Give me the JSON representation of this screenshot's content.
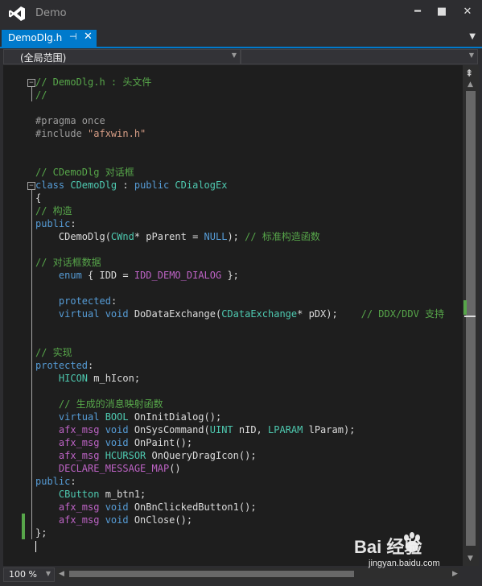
{
  "window": {
    "title": "Demo",
    "minimize": "━",
    "maximize": "■",
    "close": "✕"
  },
  "tab": {
    "label": "DemoDlg.h",
    "pin": "⊣",
    "close": "✕"
  },
  "navbar": {
    "scope": "(全局范围)",
    "member": ""
  },
  "code_lines": [
    [
      [
        "c-com",
        "// DemoDlg.h : 头文件"
      ]
    ],
    [
      [
        "c-com",
        "//"
      ]
    ],
    [],
    [
      [
        "c-pre",
        "#pragma once"
      ]
    ],
    [
      [
        "c-pre",
        "#include "
      ],
      [
        "c-str",
        "\"afxwin.h\""
      ]
    ],
    [],
    [],
    [
      [
        "c-com",
        "// CDemoDlg 对话框"
      ]
    ],
    [
      [
        "c-kw",
        "class "
      ],
      [
        "c-type",
        "CDemoDlg"
      ],
      [
        "c-txt",
        " : "
      ],
      [
        "c-kw",
        "public "
      ],
      [
        "c-type",
        "CDialogEx"
      ]
    ],
    [
      [
        "c-txt",
        "{"
      ]
    ],
    [
      [
        "c-com",
        "// 构造"
      ]
    ],
    [
      [
        "c-kw",
        "public"
      ],
      [
        "c-txt",
        ":"
      ]
    ],
    [
      [
        "c-txt",
        "    CDemoDlg("
      ],
      [
        "c-type",
        "CWnd"
      ],
      [
        "c-txt",
        "* pParent = "
      ],
      [
        "c-kw",
        "NULL"
      ],
      [
        "c-txt",
        "); "
      ],
      [
        "c-com",
        "// 标准构造函数"
      ]
    ],
    [],
    [
      [
        "c-com",
        "// 对话框数据"
      ]
    ],
    [
      [
        "c-txt",
        "    "
      ],
      [
        "c-kw",
        "enum"
      ],
      [
        "c-txt",
        " { IDD = "
      ],
      [
        "c-mac",
        "IDD_DEMO_DIALOG"
      ],
      [
        "c-txt",
        " };"
      ]
    ],
    [],
    [
      [
        "c-txt",
        "    "
      ],
      [
        "c-kw",
        "protected"
      ],
      [
        "c-txt",
        ":"
      ]
    ],
    [
      [
        "c-txt",
        "    "
      ],
      [
        "c-kw",
        "virtual void "
      ],
      [
        "c-txt",
        "DoDataExchange("
      ],
      [
        "c-type",
        "CDataExchange"
      ],
      [
        "c-txt",
        "* pDX);    "
      ],
      [
        "c-com",
        "// DDX/DDV 支持"
      ]
    ],
    [],
    [],
    [
      [
        "c-com",
        "// 实现"
      ]
    ],
    [
      [
        "c-kw",
        "protected"
      ],
      [
        "c-txt",
        ":"
      ]
    ],
    [
      [
        "c-txt",
        "    "
      ],
      [
        "c-type",
        "HICON"
      ],
      [
        "c-txt",
        " m_hIcon;"
      ]
    ],
    [],
    [
      [
        "c-txt",
        "    "
      ],
      [
        "c-com",
        "// 生成的消息映射函数"
      ]
    ],
    [
      [
        "c-txt",
        "    "
      ],
      [
        "c-kw",
        "virtual "
      ],
      [
        "c-type",
        "BOOL"
      ],
      [
        "c-txt",
        " OnInitDialog();"
      ]
    ],
    [
      [
        "c-txt",
        "    "
      ],
      [
        "c-mac",
        "afx_msg "
      ],
      [
        "c-kw",
        "void "
      ],
      [
        "c-txt",
        "OnSysCommand("
      ],
      [
        "c-type",
        "UINT"
      ],
      [
        "c-txt",
        " nID, "
      ],
      [
        "c-type",
        "LPARAM"
      ],
      [
        "c-txt",
        " lParam);"
      ]
    ],
    [
      [
        "c-txt",
        "    "
      ],
      [
        "c-mac",
        "afx_msg "
      ],
      [
        "c-kw",
        "void "
      ],
      [
        "c-txt",
        "OnPaint();"
      ]
    ],
    [
      [
        "c-txt",
        "    "
      ],
      [
        "c-mac",
        "afx_msg "
      ],
      [
        "c-type",
        "HCURSOR"
      ],
      [
        "c-txt",
        " OnQueryDragIcon();"
      ]
    ],
    [
      [
        "c-txt",
        "    "
      ],
      [
        "c-mac",
        "DECLARE_MESSAGE_MAP"
      ],
      [
        "c-txt",
        "()"
      ]
    ],
    [
      [
        "c-kw",
        "public"
      ],
      [
        "c-txt",
        ":"
      ]
    ],
    [
      [
        "c-txt",
        "    "
      ],
      [
        "c-type",
        "CButton"
      ],
      [
        "c-txt",
        " m_btn1;"
      ]
    ],
    [
      [
        "c-txt",
        "    "
      ],
      [
        "c-mac",
        "afx_msg "
      ],
      [
        "c-kw",
        "void "
      ],
      [
        "c-txt",
        "OnBnClickedButton1();"
      ]
    ],
    [
      [
        "c-txt",
        "    "
      ],
      [
        "c-mac",
        "afx_msg "
      ],
      [
        "c-kw",
        "void "
      ],
      [
        "c-txt",
        "OnClose();"
      ]
    ],
    [
      [
        "c-txt",
        "};"
      ]
    ],
    []
  ],
  "zoom": "100 %",
  "watermark": {
    "brand": "Bai  经验",
    "url": "jingyan.baidu.com"
  }
}
